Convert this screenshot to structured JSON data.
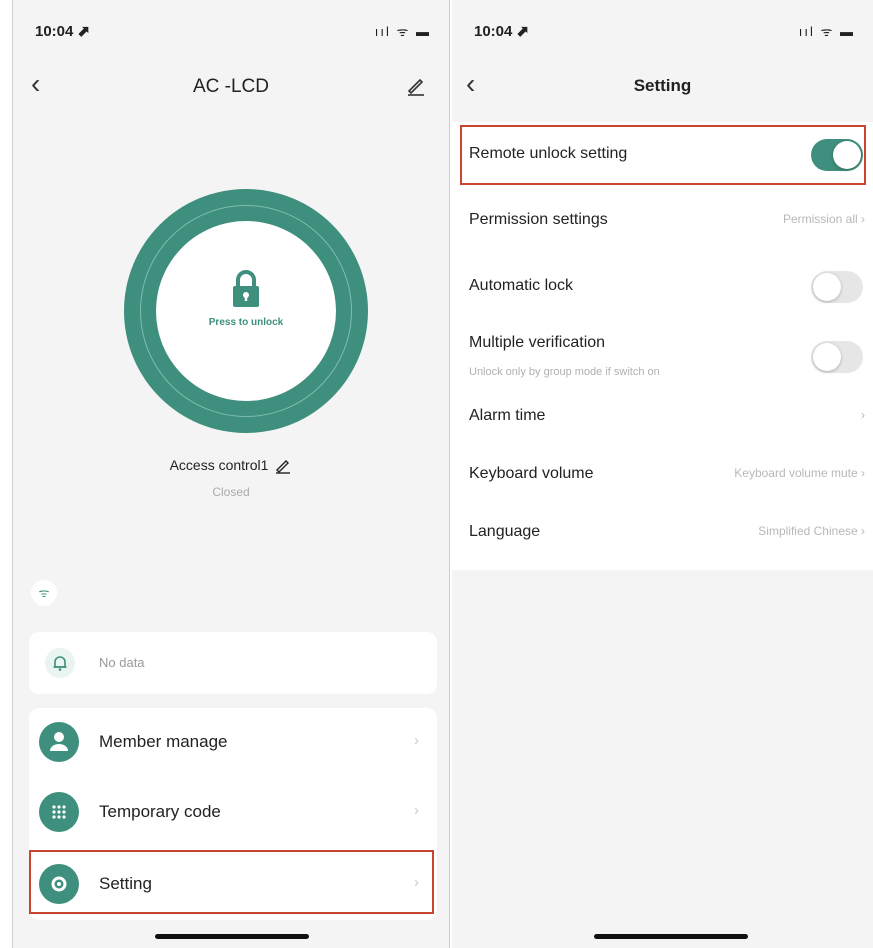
{
  "colors": {
    "accent": "#3e8f7d",
    "highlight": "#c8452f"
  },
  "left": {
    "status": {
      "time": "10:04 ⬈",
      "icons": "ııl ᯤ ▬"
    },
    "nav": {
      "back_icon": "chevron-left-icon",
      "title": "AC -LCD",
      "edit_icon": "pencil-icon"
    },
    "lock": {
      "press_text": "Press to unlock",
      "icon": "padlock-icon"
    },
    "device": {
      "name": "Access control1",
      "status": "Closed"
    },
    "wifi_icon": "wifi-icon",
    "notice": {
      "icon": "bell-icon",
      "text": "No data"
    },
    "menu": [
      {
        "label": "Member manage",
        "icon": "person-icon",
        "chevron": "›"
      },
      {
        "label": "Temporary code",
        "icon": "keypad-icon",
        "chevron": "›"
      },
      {
        "label": "Setting",
        "icon": "gear-icon",
        "chevron": "›"
      }
    ]
  },
  "right": {
    "status": {
      "time": "10:04 ⬈",
      "icons": "ııl ᯤ ▬"
    },
    "nav": {
      "back_icon": "chevron-left-icon",
      "title": "Setting"
    },
    "settings": [
      {
        "label": "Remote unlock setting",
        "toggle": true
      },
      {
        "label": "Permission settings",
        "value": "Permission all ›"
      },
      {
        "label": "Automatic lock",
        "toggle": false
      },
      {
        "label": "Multiple verification",
        "sub": "Unlock only by group mode if switch on",
        "toggle": false
      },
      {
        "label": "Alarm time",
        "value": "›"
      },
      {
        "label": "Keyboard volume",
        "value": "Keyboard volume mute ›"
      },
      {
        "label": "Language",
        "value": "Simplified Chinese ›"
      }
    ]
  }
}
